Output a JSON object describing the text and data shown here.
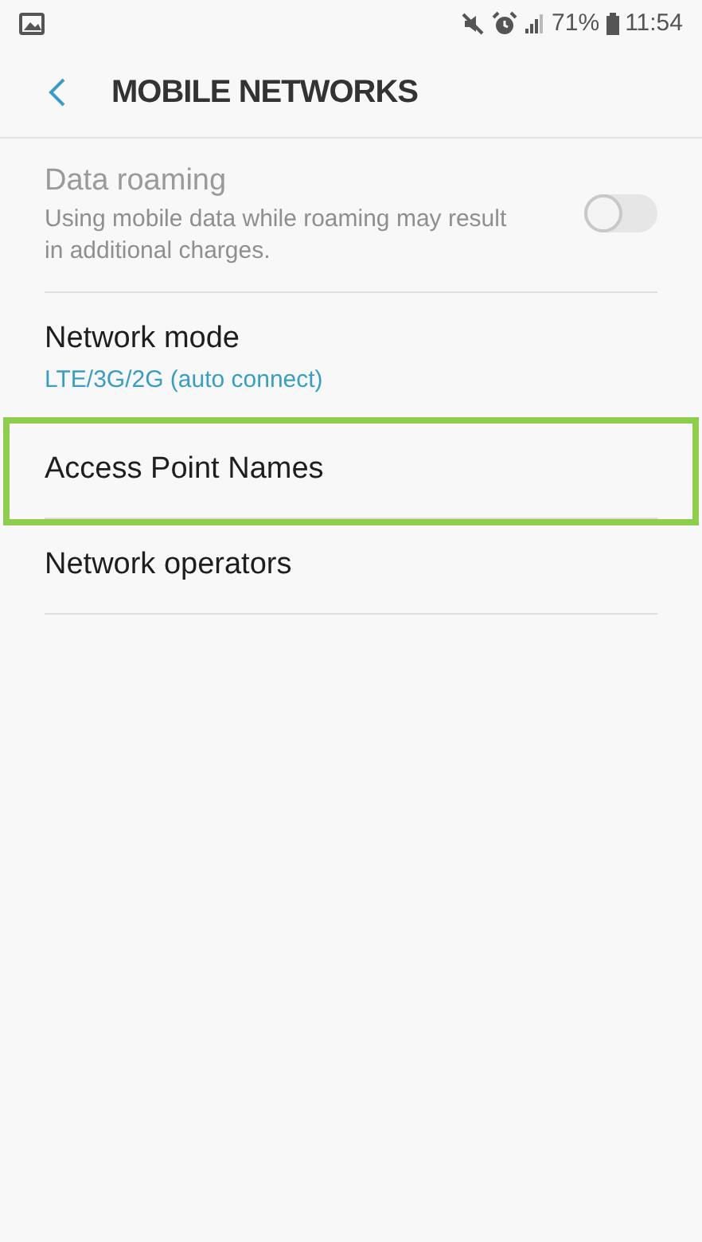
{
  "status_bar": {
    "battery": "71%",
    "time": "11:54"
  },
  "header": {
    "title": "MOBILE NETWORKS"
  },
  "items": [
    {
      "kind": "toggle",
      "title": "Data roaming",
      "subtitle": "Using mobile data while roaming may result in additional charges.",
      "disabled": true,
      "on": false,
      "highlighted": false
    },
    {
      "kind": "plain",
      "title": "Network mode",
      "value": "LTE/3G/2G (auto connect)",
      "disabled": false,
      "highlighted": false
    },
    {
      "kind": "plain",
      "title": "Access Point Names",
      "disabled": false,
      "highlighted": true
    },
    {
      "kind": "plain",
      "title": "Network operators",
      "disabled": false,
      "highlighted": false
    }
  ]
}
